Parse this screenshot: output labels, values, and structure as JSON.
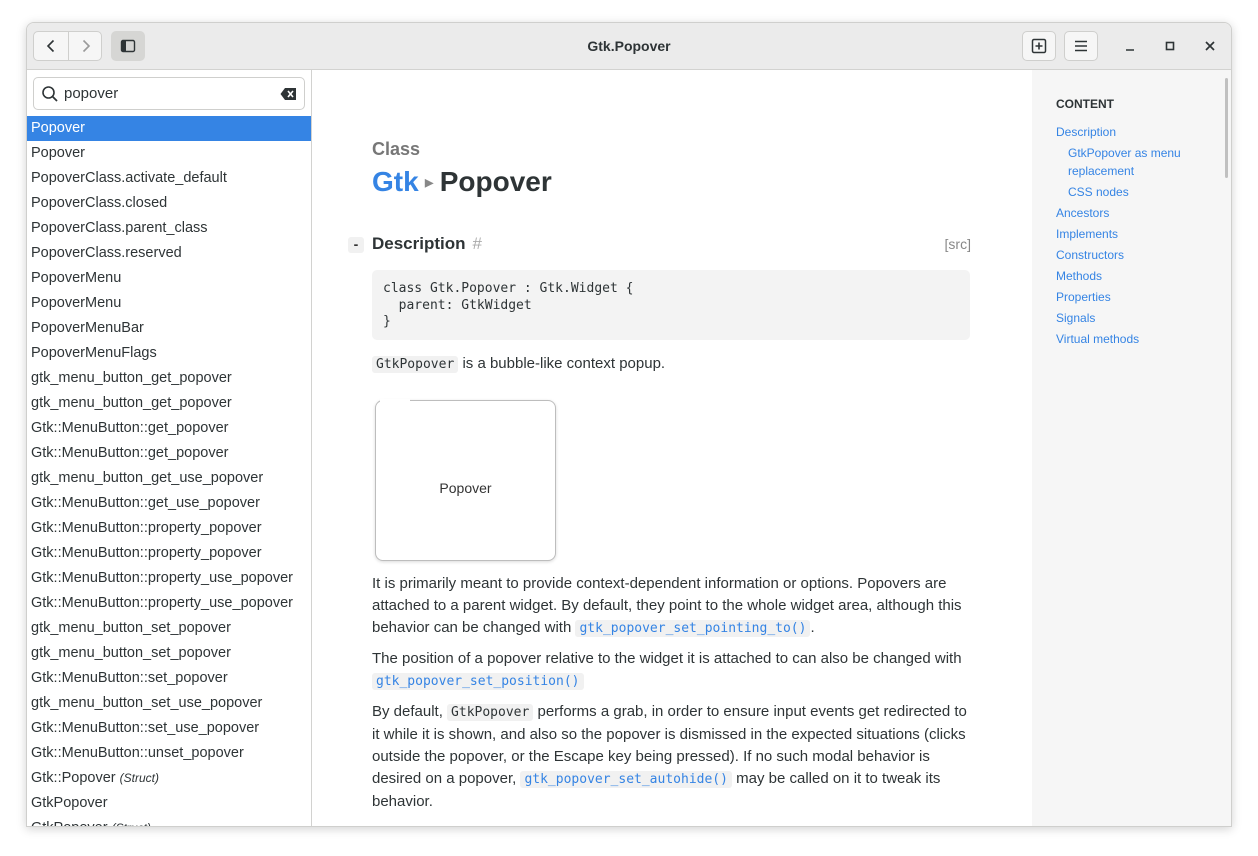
{
  "window": {
    "title": "Gtk.Popover"
  },
  "search": {
    "value": "popover"
  },
  "results": [
    {
      "label": "Popover",
      "tag": ""
    },
    {
      "label": "Popover",
      "tag": ""
    },
    {
      "label": "PopoverClass.activate_default",
      "tag": ""
    },
    {
      "label": "PopoverClass.closed",
      "tag": ""
    },
    {
      "label": "PopoverClass.parent_class",
      "tag": ""
    },
    {
      "label": "PopoverClass.reserved",
      "tag": ""
    },
    {
      "label": "PopoverMenu",
      "tag": ""
    },
    {
      "label": "PopoverMenu",
      "tag": ""
    },
    {
      "label": "PopoverMenuBar",
      "tag": ""
    },
    {
      "label": "PopoverMenuFlags",
      "tag": ""
    },
    {
      "label": "gtk_menu_button_get_popover",
      "tag": ""
    },
    {
      "label": "gtk_menu_button_get_popover",
      "tag": ""
    },
    {
      "label": "Gtk::MenuButton::get_popover",
      "tag": ""
    },
    {
      "label": "Gtk::MenuButton::get_popover",
      "tag": ""
    },
    {
      "label": "gtk_menu_button_get_use_popover",
      "tag": ""
    },
    {
      "label": "Gtk::MenuButton::get_use_popover",
      "tag": ""
    },
    {
      "label": "Gtk::MenuButton::property_popover",
      "tag": ""
    },
    {
      "label": "Gtk::MenuButton::property_popover",
      "tag": ""
    },
    {
      "label": "Gtk::MenuButton::property_use_popover",
      "tag": ""
    },
    {
      "label": "Gtk::MenuButton::property_use_popover",
      "tag": ""
    },
    {
      "label": "gtk_menu_button_set_popover",
      "tag": ""
    },
    {
      "label": "gtk_menu_button_set_popover",
      "tag": ""
    },
    {
      "label": "Gtk::MenuButton::set_popover",
      "tag": ""
    },
    {
      "label": "gtk_menu_button_set_use_popover",
      "tag": ""
    },
    {
      "label": "Gtk::MenuButton::set_use_popover",
      "tag": ""
    },
    {
      "label": "Gtk::MenuButton::unset_popover",
      "tag": ""
    },
    {
      "label": "Gtk::Popover",
      "tag": "(Struct)"
    },
    {
      "label": "GtkPopover",
      "tag": ""
    },
    {
      "label": "GtkPopover",
      "tag": "(Struct)"
    }
  ],
  "doc": {
    "kind": "Class",
    "namespace": "Gtk",
    "class_name": "Popover",
    "section_title": "Description",
    "collapse": "-",
    "anchor": "#",
    "src": "[src]",
    "code": "class Gtk.Popover : Gtk.Widget {\n  parent: GtkWidget\n}",
    "p1": {
      "code": "GtkPopover",
      "text": " is a bubble-like context popup."
    },
    "image_label": "Popover",
    "p2": {
      "text": "It is primarily meant to provide context-dependent information or options. Popovers are attached to a parent widget. By default, they point to the whole widget area, although this behavior can be changed with ",
      "link": "gtk_popover_set_pointing_to()",
      "after": "."
    },
    "p3": {
      "text": "The position of a popover relative to the widget it is attached to can also be changed with ",
      "link": "gtk_popover_set_position()"
    },
    "p4": {
      "before": "By default, ",
      "code": "GtkPopover",
      "text": " performs a grab, in order to ensure input events get redirected to it while it is shown, and also so the popover is dismissed in the expected situations (clicks outside the popover, or the Escape key being pressed). If no such modal behavior is desired on a popover, ",
      "link": "gtk_popover_set_autohide()",
      "after": " may be called on it to tweak its behavior."
    }
  },
  "toc": {
    "heading": "CONTENT",
    "items": [
      {
        "label": "Description"
      },
      {
        "label": "GtkPopover as menu"
      },
      {
        "label": "replacement"
      },
      {
        "label": "CSS nodes"
      },
      {
        "label": "Ancestors"
      },
      {
        "label": "Implements"
      },
      {
        "label": "Constructors"
      },
      {
        "label": "Methods"
      },
      {
        "label": "Properties"
      },
      {
        "label": "Signals"
      },
      {
        "label": "Virtual methods"
      }
    ]
  },
  "colors": {
    "accent": "#3584e4",
    "headerbar": "#ebebeb",
    "toc_bg": "#f6f6f6"
  },
  "icons": [
    "back-icon",
    "forward-icon",
    "sidebar-toggle-icon",
    "new-tab-icon",
    "menu-icon",
    "minimize-icon",
    "maximize-icon",
    "close-icon",
    "search-icon",
    "clear-icon"
  ]
}
